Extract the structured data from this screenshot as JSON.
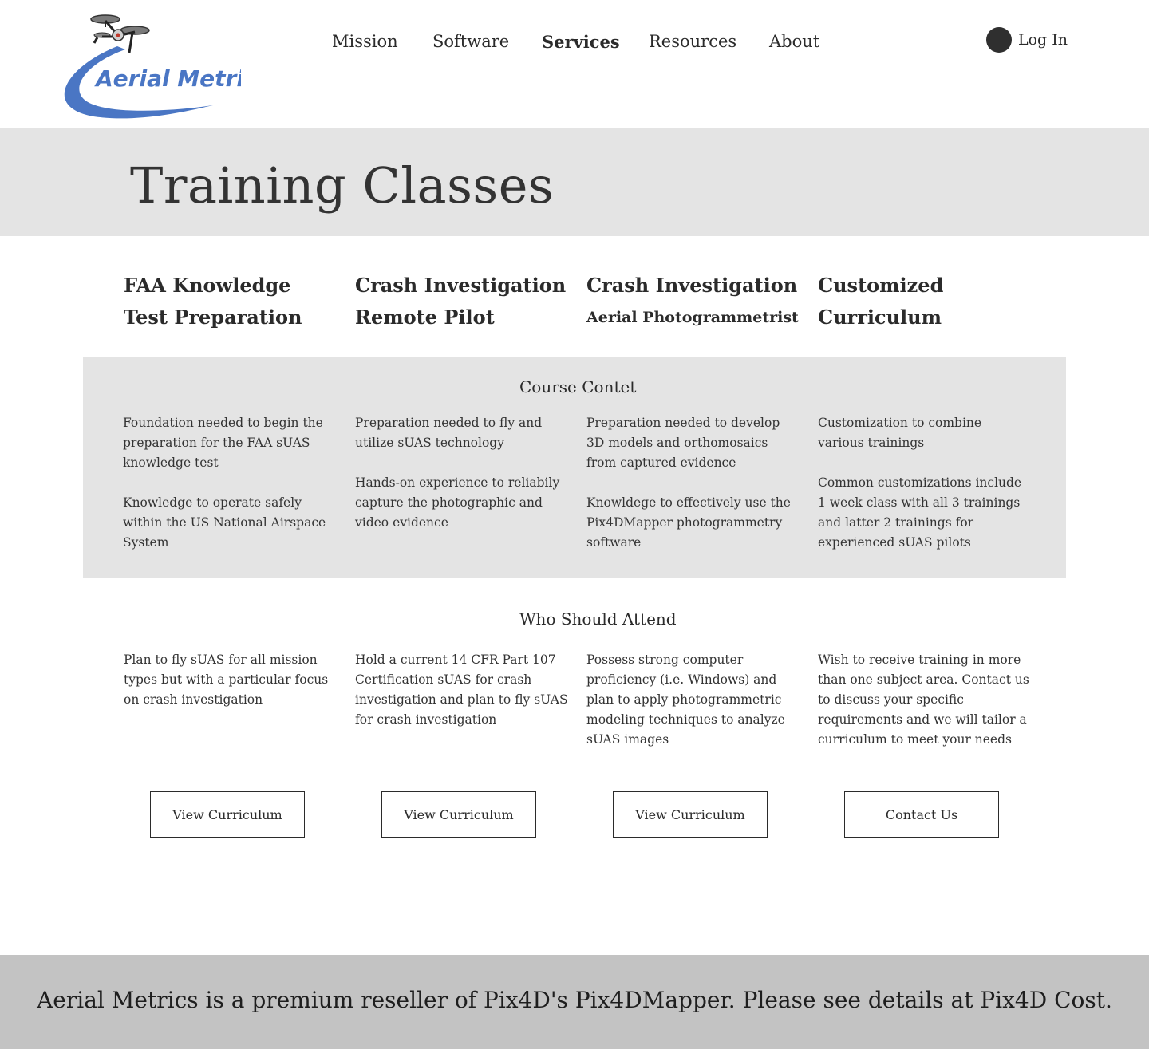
{
  "brand": {
    "name": "Aerial Metrics",
    "accent_color": "#4a76c4"
  },
  "nav": {
    "items": [
      {
        "label": "Mission",
        "active": false
      },
      {
        "label": "Software",
        "active": false
      },
      {
        "label": "Services",
        "active": true
      },
      {
        "label": "Resources",
        "active": false
      },
      {
        "label": "About",
        "active": false
      }
    ],
    "login_label": "Log In"
  },
  "page": {
    "title": "Training Classes"
  },
  "courses": [
    {
      "line1": "FAA Knowledge",
      "line2": "Test Preparation"
    },
    {
      "line1": "Crash Investigation",
      "line2": "Remote Pilot"
    },
    {
      "line1": "Crash Investigation",
      "line2": "Aerial Photogrammetrist"
    },
    {
      "line1": "Customized",
      "line2": "Curriculum"
    }
  ],
  "course_content": {
    "title": "Course Contet",
    "columns": [
      [
        "Foundation needed to begin the preparation for the FAA sUAS knowledge test",
        "Knowledge to operate safely within the US National Airspace System"
      ],
      [
        "Preparation needed to fly and utilize sUAS technology",
        "Hands-on experience to reliabily capture the photographic and video evidence"
      ],
      [
        "Preparation needed to develop 3D models and orthomosaics from captured evidence",
        "Knowldege to effectively use the Pix4DMapper photogrammetry software"
      ],
      [
        "Customization to combine various trainings",
        "Common customizations include 1 week class with all 3 trainings and latter 2 trainings for experienced sUAS pilots"
      ]
    ]
  },
  "who_should_attend": {
    "title": "Who Should Attend",
    "columns": [
      "Plan to fly sUAS for all mission types but with a particular focus on crash investigation",
      "Hold a current 14 CFR Part 107 Certification sUAS for crash investigation and plan to fly sUAS for crash investigation",
      "Possess strong computer proficiency (i.e. Windows) and plan to apply photogrammetric modeling techniques to analyze sUAS images",
      "Wish to receive training in more than one subject area. Contact us to discuss your specific requirements and we will tailor a curriculum to meet your needs"
    ]
  },
  "buttons": [
    {
      "label": "View Curriculum"
    },
    {
      "label": "View Curriculum"
    },
    {
      "label": "View Curriculum"
    },
    {
      "label": "Contact Us"
    }
  ],
  "footer": {
    "text": "Aerial Metrics is a premium reseller of Pix4D's Pix4DMapper.  Please see details at Pix4D Cost."
  }
}
